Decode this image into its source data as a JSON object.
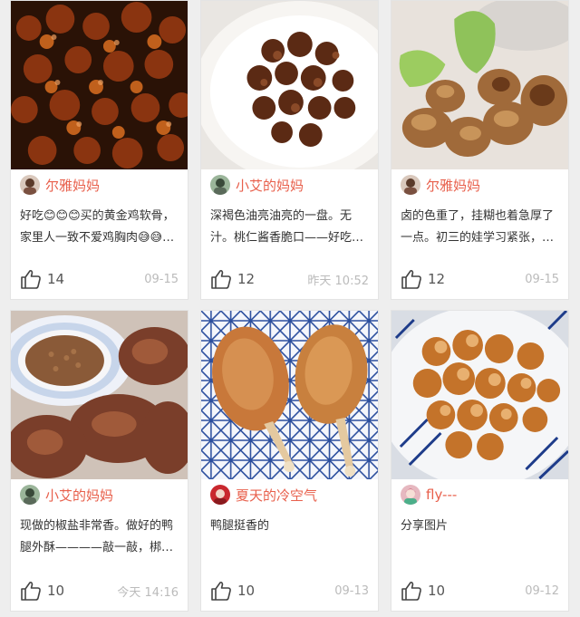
{
  "colors": {
    "accent": "#e8604c",
    "text": "#333333",
    "muted": "#bbbbbb",
    "background": "#eeeeee",
    "card": "#ffffff"
  },
  "posts": [
    {
      "author": "尔雅妈妈",
      "description": "好吃😊😊😊买的黄金鸡软骨，家里人一致不爱鸡胸肉😅😅…",
      "likes": "14",
      "date": "09-15",
      "photo": "fried-chicken-cartilage",
      "avatar": "woman-avatar"
    },
    {
      "author": "小艾的妈妈",
      "description": "深褐色油亮油亮的一盘。无汁。桃仁酱香脆口——好吃…",
      "likes": "12",
      "date": "昨天 10:52",
      "photo": "glazed-chicken-plate",
      "avatar": "child-avatar"
    },
    {
      "author": "尔雅妈妈",
      "description": "卤的色重了，挂糊也着急厚了一点。初三的娃学习紧张，…",
      "likes": "12",
      "date": "09-15",
      "photo": "battered-meat-with-lettuce",
      "avatar": "woman-avatar"
    },
    {
      "author": "小艾的妈妈",
      "description": "现做的椒盐非常香。做好的鸭腿外酥————敲一敲，梆…",
      "likes": "10",
      "date": "今天 14:16",
      "photo": "duck-legs-with-pepper-salt",
      "avatar": "child-avatar"
    },
    {
      "author": "夏天的冷空气",
      "description": "鸭腿挺香的",
      "likes": "10",
      "date": "09-13",
      "photo": "fried-duck-legs",
      "avatar": "red-avatar"
    },
    {
      "author": "fly---",
      "description": "分享图片",
      "likes": "10",
      "date": "09-12",
      "photo": "braised-chicken-bowl",
      "avatar": "girl-avatar"
    }
  ]
}
